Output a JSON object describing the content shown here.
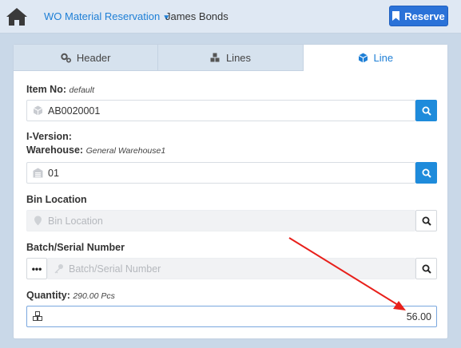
{
  "header": {
    "app_title": "WO Material Reservation",
    "user_name": "James Bonds",
    "reserve_label": "Reserve"
  },
  "tabs": [
    {
      "label": "Header",
      "icon": "gears-icon",
      "active": false
    },
    {
      "label": "Lines",
      "icon": "cubes-icon",
      "active": false
    },
    {
      "label": "Line",
      "icon": "cube-icon",
      "active": true
    }
  ],
  "form": {
    "item_no": {
      "label": "Item No:",
      "hint": "default",
      "value": "AB0020001"
    },
    "i_version": {
      "label": "I-Version:"
    },
    "warehouse": {
      "label": "Warehouse:",
      "hint": "General Warehouse1",
      "value": "01"
    },
    "bin_location": {
      "label": "Bin Location",
      "placeholder": "Bin Location"
    },
    "batch_serial": {
      "label": "Batch/Serial Number",
      "placeholder": "Batch/Serial Number",
      "more_label": "•••"
    },
    "quantity": {
      "label": "Quantity:",
      "hint": "290.00 Pcs",
      "value": "56.00"
    }
  },
  "colors": {
    "accent": "#1e8bdb",
    "reserve_button": "#2a72d8",
    "annotation_arrow": "#e8201b"
  }
}
